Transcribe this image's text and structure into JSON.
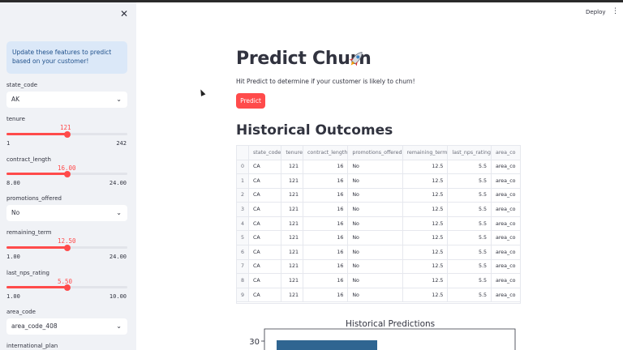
{
  "sidebar": {
    "info_text": "Update these features to predict based on your customer!",
    "state_code": {
      "label": "state_code",
      "value": "AK"
    },
    "tenure": {
      "label": "tenure",
      "value": "121",
      "min": "1",
      "max": "242",
      "fraction": 0.5
    },
    "contract_length": {
      "label": "contract_length",
      "value": "16.00",
      "min": "8.00",
      "max": "24.00",
      "fraction": 0.5
    },
    "promotions_offered": {
      "label": "promotions_offered",
      "value": "No"
    },
    "remaining_term": {
      "label": "remaining_term",
      "value": "12.50",
      "min": "1.00",
      "max": "24.00",
      "fraction": 0.5
    },
    "last_nps_rating": {
      "label": "last_nps_rating",
      "value": "5.50",
      "min": "1.00",
      "max": "10.00",
      "fraction": 0.5
    },
    "area_code": {
      "label": "area_code",
      "value": "area_code_408"
    },
    "international_plan": {
      "label": "international_plan"
    }
  },
  "header": {
    "deploy_label": "Deploy",
    "menu_icon": "kebab-menu-icon"
  },
  "main": {
    "title": "Predict Churn",
    "title_icon": "rocket-icon",
    "caption": "Hit Predict to determine if your customer is likely to churn!",
    "predict_label": "Predict",
    "section_title": "Historical Outcomes",
    "table": {
      "columns": [
        "",
        "state_code",
        "tenure",
        "contract_length",
        "promotions_offered",
        "remaining_term",
        "last_nps_rating",
        "area_co"
      ],
      "rows": [
        [
          "0",
          "CA",
          "121",
          "16",
          "No",
          "12.5",
          "5.5",
          "area_co"
        ],
        [
          "1",
          "CA",
          "121",
          "16",
          "No",
          "12.5",
          "5.5",
          "area_co"
        ],
        [
          "2",
          "CA",
          "121",
          "16",
          "No",
          "12.5",
          "5.5",
          "area_co"
        ],
        [
          "3",
          "CA",
          "121",
          "16",
          "No",
          "12.5",
          "5.5",
          "area_co"
        ],
        [
          "4",
          "CA",
          "121",
          "16",
          "No",
          "12.5",
          "5.5",
          "area_co"
        ],
        [
          "5",
          "CA",
          "121",
          "16",
          "No",
          "12.5",
          "5.5",
          "area_co"
        ],
        [
          "6",
          "CA",
          "121",
          "16",
          "No",
          "12.5",
          "5.5",
          "area_co"
        ],
        [
          "7",
          "CA",
          "121",
          "16",
          "No",
          "12.5",
          "5.5",
          "area_co"
        ],
        [
          "8",
          "CA",
          "121",
          "16",
          "No",
          "12.5",
          "5.5",
          "area_co"
        ],
        [
          "9",
          "CA",
          "121",
          "16",
          "No",
          "12.5",
          "5.5",
          "area_co"
        ]
      ]
    },
    "chart_title": "Historical Predictions"
  },
  "chart_data": {
    "type": "bar",
    "title": "Historical Predictions",
    "yticks": [
      "30"
    ],
    "bar_color": "#2f6591"
  },
  "colors": {
    "accent": "#ff4b4b",
    "sidebar_bg": "#f0f2f6",
    "info_bg": "#dbe8f8"
  }
}
